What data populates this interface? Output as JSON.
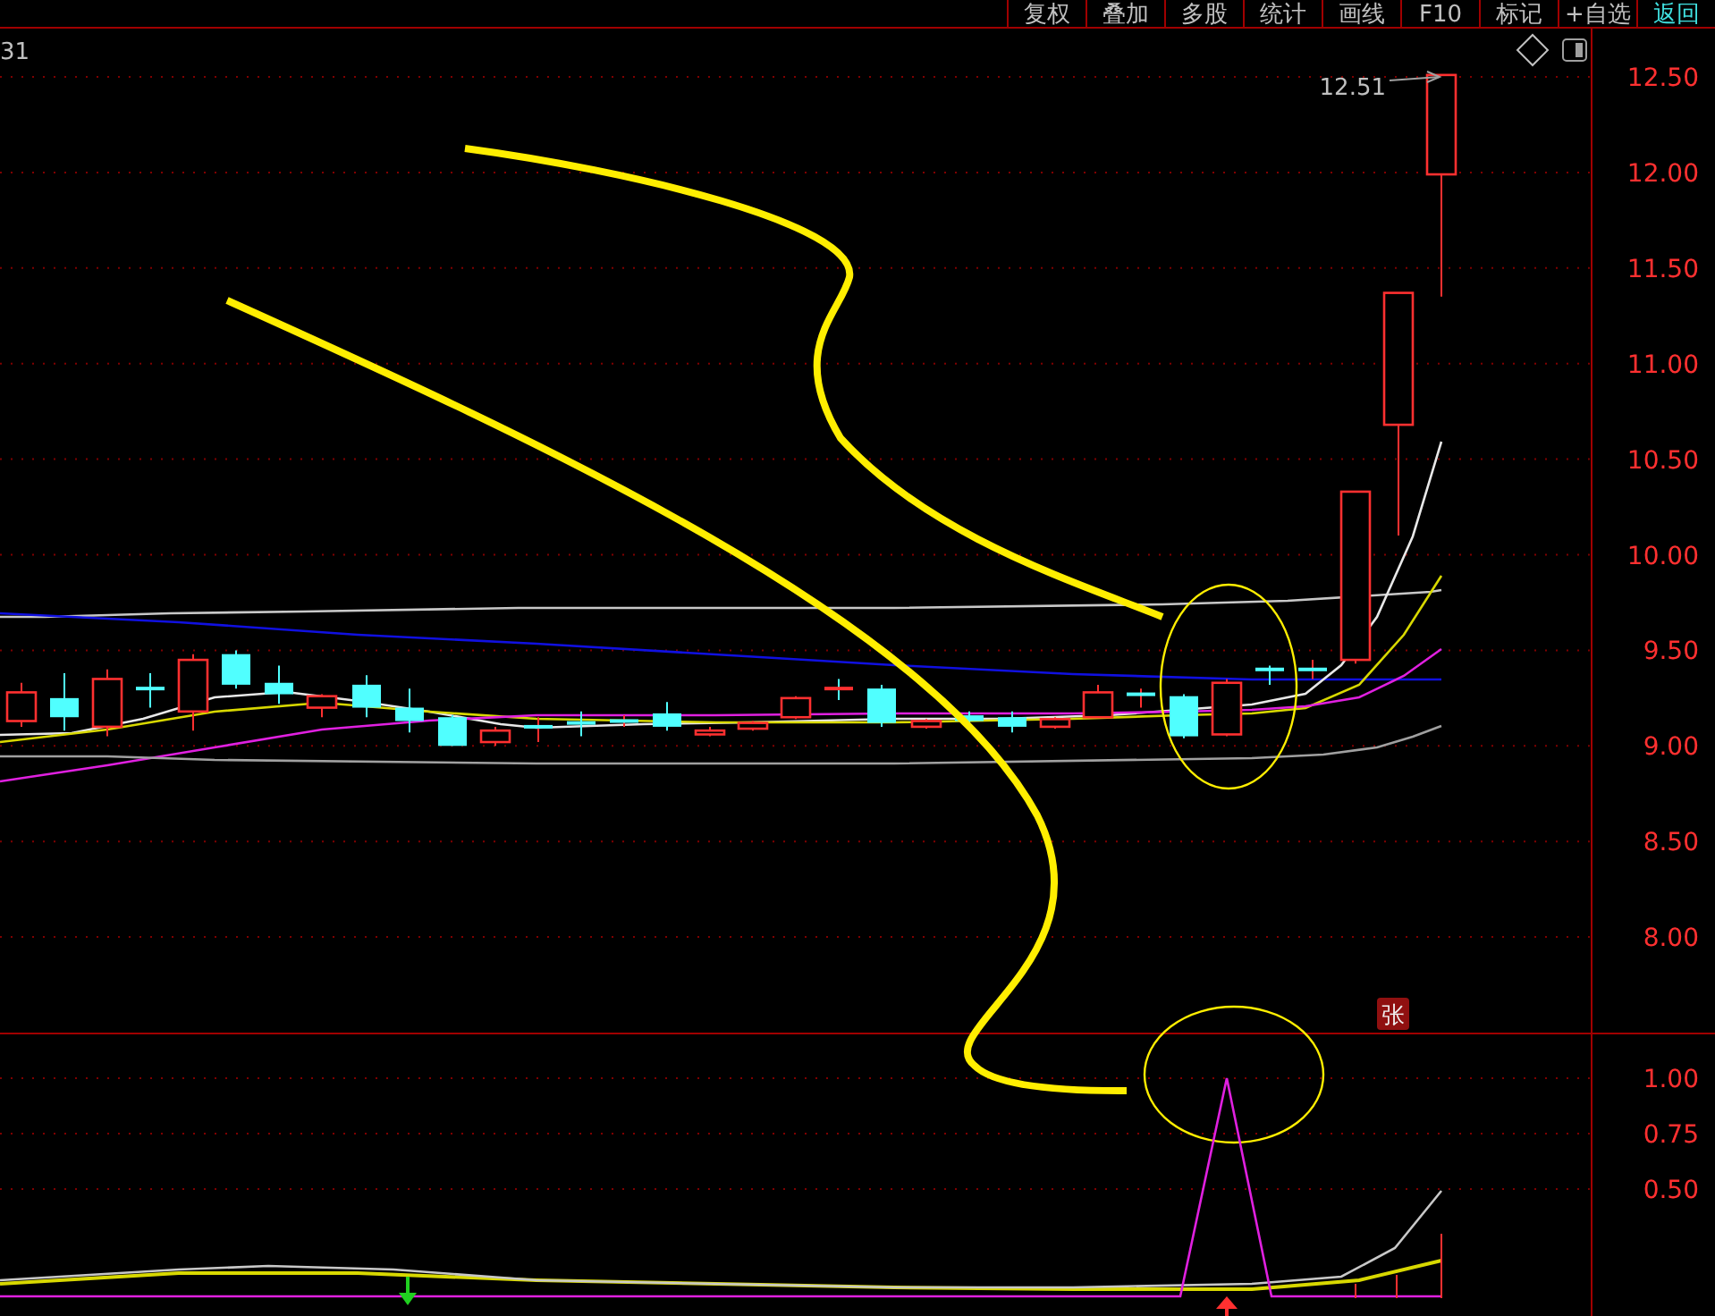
{
  "toolbar": [
    {
      "label": "复权",
      "highlighted": false
    },
    {
      "label": "叠加",
      "highlighted": false
    },
    {
      "label": "多股",
      "highlighted": false
    },
    {
      "label": "统计",
      "highlighted": false
    },
    {
      "label": "画线",
      "highlighted": false
    },
    {
      "label": "F10",
      "highlighted": false
    },
    {
      "label": "标记",
      "highlighted": false
    },
    {
      "label": "+自选",
      "highlighted": false
    },
    {
      "label": "返回",
      "highlighted": true
    }
  ],
  "chart": {
    "corner_text": "31",
    "last_price": "12.51",
    "price_axis": [
      "12.50",
      "12.00",
      "11.50",
      "11.00",
      "10.50",
      "10.00",
      "9.50",
      "9.00",
      "8.50",
      "8.00"
    ],
    "limit_badge": "张"
  },
  "indicator": {
    "axis": [
      "1.00",
      "0.75",
      "0.50"
    ]
  }
}
